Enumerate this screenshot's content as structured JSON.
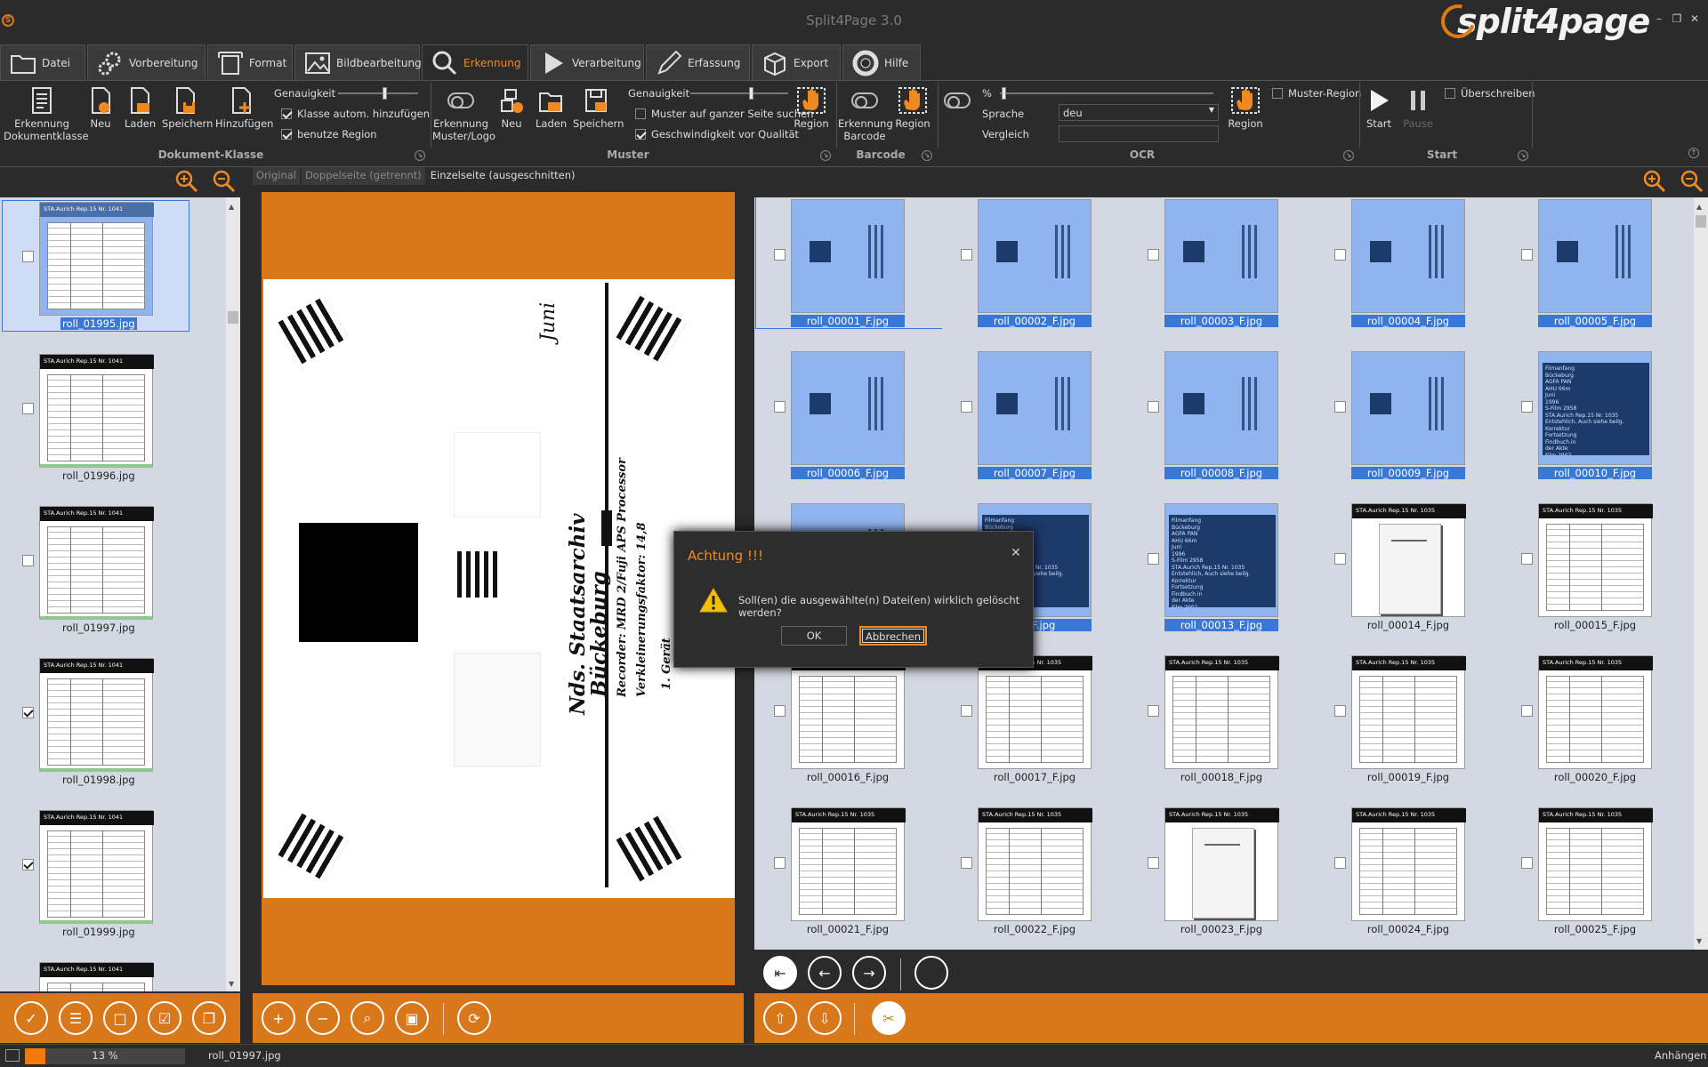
{
  "window": {
    "title": "Split4Page 3.0",
    "logo": "split4page",
    "app_icon": "S"
  },
  "tabs": [
    {
      "label": "Datei",
      "icon": "folder-icon"
    },
    {
      "label": "Vorbereitung",
      "icon": "gears-icon"
    },
    {
      "label": "Format",
      "icon": "format-icon"
    },
    {
      "label": "Bildbearbeitung",
      "icon": "image-icon"
    },
    {
      "label": "Erkennung",
      "icon": "magnifier-icon",
      "active": true
    },
    {
      "label": "Verarbeitung",
      "icon": "play-icon"
    },
    {
      "label": "Erfassung",
      "icon": "pen-icon"
    },
    {
      "label": "Export",
      "icon": "box-icon"
    },
    {
      "label": "Hilfe",
      "icon": "lifebuoy-icon"
    }
  ],
  "ribbon": {
    "doc_class": {
      "group": "Dokument-Klasse",
      "erkennung": "Erkennung",
      "erkennung2": "Dokumentklasse",
      "neu": "Neu",
      "laden": "Laden",
      "speichern": "Speichern",
      "hinzufuegen": "Hinzufügen",
      "genauigkeit": "Genauigkeit",
      "klasse_auto": "Klasse autom. hinzufügen",
      "benutze_region": "benutze Region"
    },
    "muster": {
      "group": "Muster",
      "erkennung": "Erkennung",
      "erkennung2": "Muster/Logo",
      "neu": "Neu",
      "laden": "Laden",
      "speichern": "Speichern",
      "genauigkeit": "Genauigkeit",
      "ganze_seite": "Muster auf ganzer Seite suchen",
      "geschwindigkeit": "Geschwindigkeit vor Qualität",
      "region": "Region"
    },
    "barcode": {
      "group": "Barcode",
      "erkennung": "Erkennung",
      "erkennung2": "Barcode",
      "region": "Region"
    },
    "ocr": {
      "group": "OCR",
      "percent": "%",
      "sprache": "Sprache",
      "sprache_value": "deu",
      "vergleich": "Vergleich",
      "region": "Region",
      "muster_region": "Muster-Region"
    },
    "start": {
      "group": "Start",
      "start": "Start",
      "pause": "Pause",
      "ueberschreiben": "Überschreiben"
    }
  },
  "left_list": {
    "items": [
      {
        "name": "roll_01995.jpg",
        "selected": true,
        "checked": false
      },
      {
        "name": "roll_01996.jpg",
        "selected": false,
        "checked": false
      },
      {
        "name": "roll_01997.jpg",
        "selected": false,
        "checked": false
      },
      {
        "name": "roll_01998.jpg",
        "selected": false,
        "checked": true
      },
      {
        "name": "roll_01999.jpg",
        "selected": false,
        "checked": true
      }
    ],
    "header_text": "STA.Aurich Rep.15 Nr. 1041"
  },
  "view_tabs": [
    "Original",
    "Doppelseite (getrennt)",
    "Einzelseite (ausgeschnitten)"
  ],
  "preview_text": {
    "juni": "Juni",
    "line1": "Nds. Staatsarchiv",
    "line2": "Bückeburg",
    "line3": "Recorder: MRD 2/Fuji APS Processor",
    "line4": "Verkleinerungsfaktor: 14,8",
    "line5": "1. Gerät"
  },
  "grid": {
    "items": [
      {
        "name": "roll_00001_F.jpg",
        "selected": true,
        "type": "envelope"
      },
      {
        "name": "roll_00002_F.jpg",
        "selected": true,
        "type": "envelope"
      },
      {
        "name": "roll_00003_F.jpg",
        "selected": true,
        "type": "envelope"
      },
      {
        "name": "roll_00004_F.jpg",
        "selected": true,
        "type": "envelope"
      },
      {
        "name": "roll_00005_F.jpg",
        "selected": true,
        "type": "envelope"
      },
      {
        "name": "roll_00006_F.jpg",
        "selected": true,
        "type": "envelope"
      },
      {
        "name": "roll_00007_F.jpg",
        "selected": true,
        "type": "envelope"
      },
      {
        "name": "roll_00008_F.jpg",
        "selected": true,
        "type": "envelope"
      },
      {
        "name": "roll_00009_F.jpg",
        "selected": true,
        "type": "envelope"
      },
      {
        "name": "roll_00010_F.jpg",
        "selected": true,
        "type": "card"
      },
      {
        "name": "",
        "selected": true,
        "type": "envelope"
      },
      {
        "name": "12_F.jpg",
        "selected": true,
        "type": "card"
      },
      {
        "name": "roll_00013_F.jpg",
        "selected": true,
        "type": "card"
      },
      {
        "name": "roll_00014_F.jpg",
        "selected": false,
        "type": "page"
      },
      {
        "name": "roll_00015_F.jpg",
        "selected": false,
        "type": "table"
      },
      {
        "name": "roll_00016_F.jpg",
        "selected": false,
        "type": "table"
      },
      {
        "name": "roll_00017_F.jpg",
        "selected": false,
        "type": "table"
      },
      {
        "name": "roll_00018_F.jpg",
        "selected": false,
        "type": "table"
      },
      {
        "name": "roll_00019_F.jpg",
        "selected": false,
        "type": "table"
      },
      {
        "name": "roll_00020_F.jpg",
        "selected": false,
        "type": "table"
      },
      {
        "name": "roll_00021_F.jpg",
        "selected": false,
        "type": "table"
      },
      {
        "name": "roll_00022_F.jpg",
        "selected": false,
        "type": "table"
      },
      {
        "name": "roll_00023_F.jpg",
        "selected": false,
        "type": "page"
      },
      {
        "name": "roll_00024_F.jpg",
        "selected": false,
        "type": "table"
      },
      {
        "name": "roll_00025_F.jpg",
        "selected": false,
        "type": "table"
      }
    ],
    "header_text": "STA.Aurich Rep.15 Nr. 1035",
    "card_lines": [
      "Filmanfang",
      "Bückeburg",
      "AGFA PAN",
      "AHU 66m",
      "Juni",
      "1996",
      "S-Film 2958",
      "STA.Aurich Rep.15 Nr. 1035",
      "Entstehlich, Auch siehe beilg. Korrektur",
      "Fortsetzung",
      "Findbuch in",
      "der Akte",
      "Film 2902"
    ]
  },
  "dialog": {
    "title": "Achtung !!!",
    "message": "Soll(en) die ausgewählte(n) Datei(en) wirklich gelöscht werden?",
    "ok": "OK",
    "cancel": "Abbrechen"
  },
  "status": {
    "progress": 13,
    "progress_label": "13 %",
    "current_file": "roll_01997.jpg",
    "right": "Anhängen"
  },
  "colors": {
    "accent": "#f08a20",
    "bar": "#d9781a",
    "selection": "#3a78d8"
  }
}
